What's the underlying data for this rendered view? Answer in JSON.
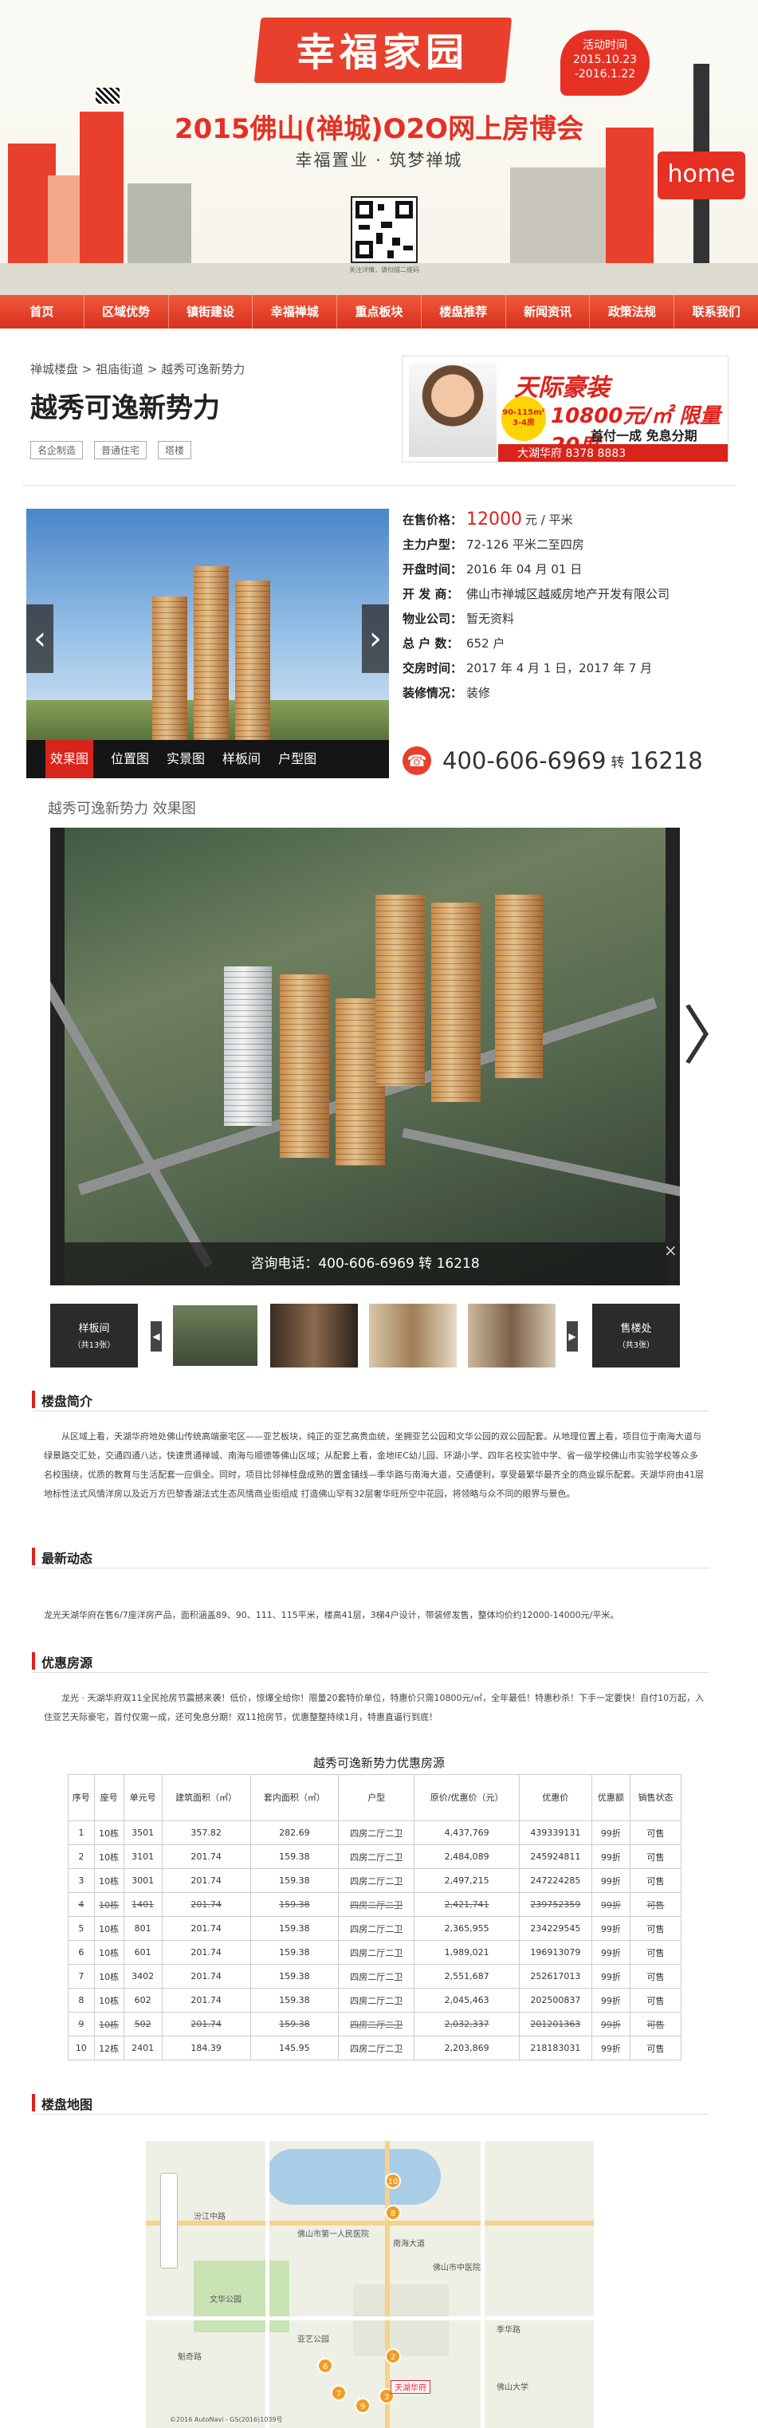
{
  "banner": {
    "logo_text": "幸福家园",
    "activity_label": "活动时间",
    "activity_dates": "2015.10.23 -2016.1.22",
    "title": "2015佛山(禅城)O2O网上房博会",
    "subtitle": "幸福置业 · 筑梦禅城",
    "qr_caption": "关注详情，请扫描二维码",
    "home_sign": "home"
  },
  "nav": [
    "首页",
    "区域优势",
    "镇街建设",
    "幸福禅城",
    "重点板块",
    "楼盘推荐",
    "新闻资讯",
    "政策法规",
    "联系我们"
  ],
  "breadcrumb": "禅城楼盘 > 祖庙街道 > 越秀可逸新势力",
  "project": {
    "title": "越秀可逸新势力",
    "tags": [
      "名企制造",
      "普通住宅",
      "塔楼"
    ]
  },
  "ad": {
    "line1": "天际豪装",
    "line2": "10800元/㎡ 限量20席",
    "line3": "首付一成 免息分期",
    "badge": "90-115m² 3-4房",
    "strip": "大湖华府 8378 8883"
  },
  "gallery": {
    "tabs": [
      "效果图",
      "位置图",
      "实景图",
      "样板间",
      "户型图"
    ],
    "prev": "‹",
    "next": "›"
  },
  "info": {
    "price_label": "在售价格：",
    "price_value": "12000",
    "price_unit": "元 / 平米",
    "rows": [
      {
        "k": "主力户型：",
        "v": "72-126 平米二至四房"
      },
      {
        "k": "开盘时间：",
        "v": "2016 年 04 月 01 日"
      },
      {
        "k": "开 发 商：",
        "v": "佛山市禅城区越威房地产开发有限公司"
      },
      {
        "k": "物业公司：",
        "v": "暂无资料"
      },
      {
        "k": "总 户 数：",
        "v": "652 户"
      },
      {
        "k": "交房时间：",
        "v": "2017 年 4 月 1 日，2017 年 7 月"
      },
      {
        "k": "装修情况：",
        "v": "装修"
      }
    ],
    "hotline": "400-606-6969",
    "hotline_sep": "转",
    "hotline_ext": "16218"
  },
  "viewer": {
    "title": "越秀可逸新势力 效果图",
    "caption": "咨询电话：400-606-6969 转 16218",
    "close": "×",
    "left_arrow": "〈",
    "right_arrow": "〉",
    "thumb_left_label": "样板间",
    "thumb_left_count": "（共13张）",
    "thumb_right_label": "售楼处",
    "thumb_right_count": "（共3张）"
  },
  "sections": {
    "intro_title": "楼盘简介",
    "intro_text": "从区域上看，天湖华府地处佛山传统高端豪宅区——亚艺板块，纯正的亚艺高贵血统，坐拥亚艺公园和文华公园的双公园配套。从地理位置上看，项目位于南海大道与绿景路交汇处，交通四通八达，快速贯通禅城、南海与顺德等佛山区域；从配套上看，金地IEC幼儿园、环湖小学、四年名校实验中学、省一级学校佛山市实验学校等众多名校围绕，优质的教育与生活配套一应俱全。同时，项目比邻禅桂盘成熟的置金铺线—季华路与南海大道，交通便利，享受最繁华最齐全的商业娱乐配套。天湖华府由41层地标性法式风情洋房以及近万方巴黎香湖法式生态风情商业街组成 打造佛山罕有32层奢华旺所空中花园，将领略与众不同的眼界与景色。",
    "news_title": "最新动态",
    "news_text": "龙光天湖华府在售6/7座洋房产品，面积涵盖89、90、111、115平米，楼高41层，3梯4户设计，带装修发售，整体均价约12000-14000元/平米。",
    "promo_title": "优惠房源",
    "promo_text": "龙光 · 天湖华府双11全民抢房节震撼来袭！低价，惊爆全给你！限量20套特价单位，特惠价只需10800元/㎡，全年最低！特惠秒杀！下手一定要快！自付10万起，入住亚艺天际豪宅，首付仅需一成，还可免息分期！双11抢房节，优惠整整持续1月，特惠直逼行到底！",
    "table_title": "越秀可逸新势力优惠房源",
    "map_title": "楼盘地图"
  },
  "table": {
    "headers": [
      "序号",
      "座号",
      "单元号",
      "建筑面积（㎡）",
      "套内面积（㎡）",
      "户型",
      "原价/优惠价（元）",
      "优惠价",
      "优惠额",
      "销售状态"
    ],
    "rows": [
      {
        "cells": [
          "1",
          "10栋",
          "3501",
          "357.82",
          "282.69",
          "四房二厅二卫",
          "4,437,769",
          "439339131",
          "99折",
          "可售"
        ],
        "strike": false
      },
      {
        "cells": [
          "2",
          "10栋",
          "3101",
          "201.74",
          "159.38",
          "四房二厅二卫",
          "2,484,089",
          "245924811",
          "99折",
          "可售"
        ],
        "strike": false
      },
      {
        "cells": [
          "3",
          "10栋",
          "3001",
          "201.74",
          "159.38",
          "四房二厅二卫",
          "2,497,215",
          "247224285",
          "99折",
          "可售"
        ],
        "strike": false
      },
      {
        "cells": [
          "4",
          "10栋",
          "1401",
          "201.74",
          "159.38",
          "四房二厅二卫",
          "2,421,741",
          "239752359",
          "99折",
          "可售"
        ],
        "strike": true
      },
      {
        "cells": [
          "5",
          "10栋",
          "801",
          "201.74",
          "159.38",
          "四房二厅二卫",
          "2,365,955",
          "234229545",
          "99折",
          "可售"
        ],
        "strike": false
      },
      {
        "cells": [
          "6",
          "10栋",
          "601",
          "201.74",
          "159.38",
          "四房二厅二卫",
          "1,989,021",
          "196913079",
          "99折",
          "可售"
        ],
        "strike": false
      },
      {
        "cells": [
          "7",
          "10栋",
          "3402",
          "201.74",
          "159.38",
          "四房二厅二卫",
          "2,551,687",
          "252617013",
          "99折",
          "可售"
        ],
        "strike": false
      },
      {
        "cells": [
          "8",
          "10栋",
          "602",
          "201.74",
          "159.38",
          "四房二厅二卫",
          "2,045,463",
          "202500837",
          "99折",
          "可售"
        ],
        "strike": false
      },
      {
        "cells": [
          "9",
          "10栋",
          "502",
          "201.74",
          "159.38",
          "四房二厅二卫",
          "2,032,337",
          "201201363",
          "99折",
          "可售"
        ],
        "strike": true
      },
      {
        "cells": [
          "10",
          "12栋",
          "2401",
          "184.39",
          "145.95",
          "四房二厅二卫",
          "2,203,869",
          "218183031",
          "99折",
          "可售"
        ],
        "strike": false
      }
    ]
  },
  "map": {
    "pins": [
      "10",
      "2",
      "3",
      "6",
      "7",
      "8",
      "9"
    ],
    "labels": [
      "佛山市第一人民医院",
      "佛山市中医院",
      "南海大道",
      "汾江中路",
      "季华路",
      "魁奇路",
      "文华公园",
      "亚艺公园",
      "佛山大学"
    ],
    "tag": "天湖华府",
    "copyright": "©2016 AutoNavi - GS(2016)1039号"
  },
  "colors": {
    "accent": "#e0201a",
    "nav": "#e8402c"
  }
}
